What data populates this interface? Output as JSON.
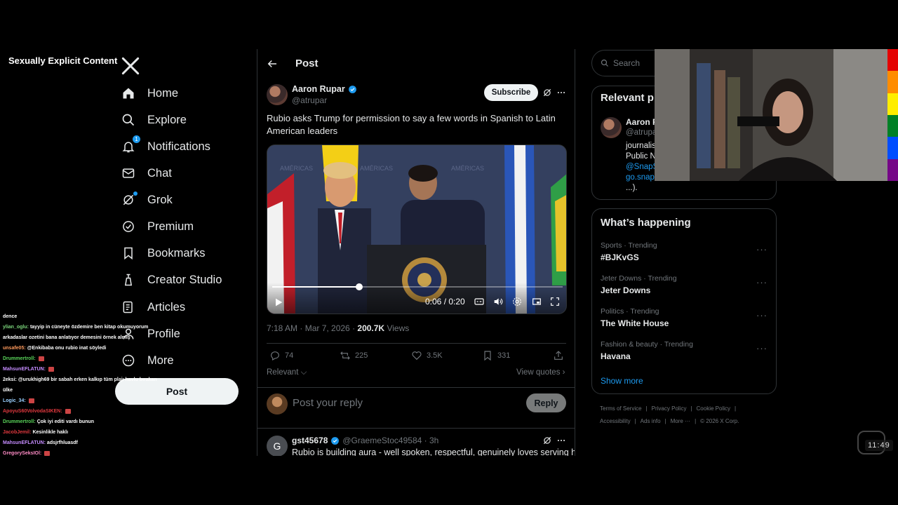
{
  "overlay": {
    "explicit_label": "Sexually Explicit Content",
    "clock": "11:49"
  },
  "nav": {
    "items": [
      {
        "label": "Home",
        "icon": "home-icon"
      },
      {
        "label": "Explore",
        "icon": "search-icon"
      },
      {
        "label": "Notifications",
        "icon": "bell-icon",
        "badge": "1"
      },
      {
        "label": "Chat",
        "icon": "mail-icon"
      },
      {
        "label": "Grok",
        "icon": "grok-icon"
      },
      {
        "label": "Premium",
        "icon": "verified-badge-icon"
      },
      {
        "label": "Bookmarks",
        "icon": "bookmark-icon"
      },
      {
        "label": "Creator Studio",
        "icon": "creator-studio-icon"
      },
      {
        "label": "Articles",
        "icon": "article-icon"
      },
      {
        "label": "Profile",
        "icon": "profile-icon"
      },
      {
        "label": "More",
        "icon": "more-circle-icon"
      }
    ],
    "post_button": "Post"
  },
  "chat": {
    "lines": [
      {
        "user": "",
        "text": "dence",
        "color": "#ffffff"
      },
      {
        "user": "ylian_oglu:",
        "text": "tayyip in cüneyte özdemire ben kitap okumuyorum",
        "color": "#7cd67c"
      },
      {
        "user": "",
        "text": "arkadaslar ozetini bana anlatıyor demesini örnek almış",
        "color": "#ffffff"
      },
      {
        "user": "unsafe05:",
        "text": "@Enkibaba onu rubio inat söyledi",
        "color": "#ff9a5c"
      },
      {
        "user": "Drummertroll:",
        "text": "",
        "color": "#5ad65a"
      },
      {
        "user": "MahsunEFLATUN:",
        "text": "",
        "color": "#c58cff"
      },
      {
        "user": "2eksi:",
        "text": "@urukhigh69 bir sabah erken kalkıp tüm plajı havlu bırakan",
        "color": "#ffffff"
      },
      {
        "user": "",
        "text": "ülke",
        "color": "#ffffff"
      },
      {
        "user": "Logic_34:",
        "text": "",
        "color": "#9ad0ff"
      },
      {
        "user": "ApoyuS60VolvodaSIKEN:",
        "text": "",
        "color": "#e0383e"
      },
      {
        "user": "Drummertroll:",
        "text": "Çok iyi editi vardı bunun",
        "color": "#5ad65a"
      },
      {
        "user": "JacobJemil:",
        "text": "Kesinlikle haklı",
        "color": "#e0383e"
      },
      {
        "user": "MahsunEFLATUN:",
        "text": "adsjrfhluasdf",
        "color": "#c58cff"
      },
      {
        "user": "GregorySeksIOl:",
        "text": "",
        "color": "#ff8cc6"
      }
    ]
  },
  "main": {
    "header_title": "Post",
    "tweet": {
      "author": "Aaron Rupar",
      "handle": "@atrupar",
      "subscribe": "Subscribe",
      "text": "Rubio asks Trump for permission to say a few words in Spanish to Latin American leaders",
      "video_time": "0:06 / 0:20",
      "video_progress": 0.3,
      "timestamp": "7:18 AM · Mar 7, 2026 · ",
      "views_count": "200.7K",
      "views_label": " Views",
      "replies": "74",
      "reposts": "225",
      "likes": "3.5K",
      "bookmarks": "331"
    },
    "sort_label": "Relevant",
    "view_quotes": "View quotes",
    "reply_placeholder": "Post your reply",
    "reply_button": "Reply",
    "first_reply": {
      "avatar_letter": "G",
      "author": "gst45678",
      "handle": "@GraemeStoc49584 · 3h",
      "text": "Rubio is building aura - well spoken, respectful, genuinely loves serving his"
    }
  },
  "sidebar": {
    "search_placeholder": "Search",
    "relevant_title": "Relevant p",
    "relevant_person": {
      "name": "Aaron R",
      "handle": "@atrupa",
      "bio_lines": [
        "journalis",
        "Public N",
        "@SnapS",
        "go.snap",
        "...)."
      ]
    },
    "happening_title": "What’s happening",
    "trends": [
      {
        "category": "Sports · Trending",
        "name": "#BJKvGS"
      },
      {
        "category": "Jeter Downs · Trending",
        "name": "Jeter Downs"
      },
      {
        "category": "Politics · Trending",
        "name": "The White House"
      },
      {
        "category": "Fashion & beauty · Trending",
        "name": "Havana"
      }
    ],
    "show_more": "Show more",
    "footer_row1": [
      "Terms of Service",
      "|",
      "Privacy Policy",
      "|",
      "Cookie Policy",
      "|"
    ],
    "footer_row2": [
      "Accessibility",
      "|",
      "Ads info",
      "|",
      "More ···",
      "|",
      "© 2026 X Corp."
    ]
  },
  "colors": {
    "accent": "#1d9bf0",
    "background": "#000000",
    "border": "#2f3336",
    "muted": "#71767b",
    "rainbow": [
      "#e40303",
      "#ff8c00",
      "#ffed00",
      "#008026",
      "#004dff",
      "#750787"
    ]
  }
}
